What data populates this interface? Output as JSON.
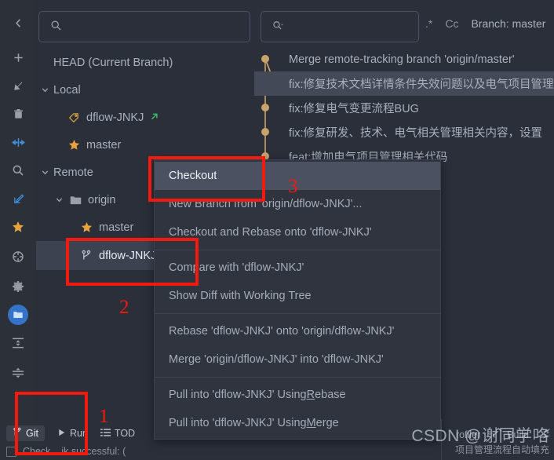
{
  "window": {
    "background": "#2b2f3a",
    "accent": "#3c7ef0"
  },
  "toolstrip": {
    "icons": [
      {
        "name": "collapse-left-icon",
        "glyph": "chevron-left"
      },
      {
        "name": "add-icon",
        "glyph": "plus"
      },
      {
        "name": "import-arrow-icon",
        "glyph": "arrow-down-left"
      },
      {
        "name": "delete-icon",
        "glyph": "trash"
      },
      {
        "name": "collapse-all-icon",
        "glyph": "collapse-arrows"
      },
      {
        "name": "search-icon",
        "glyph": "magnifier"
      },
      {
        "name": "edit-icon",
        "glyph": "pencil-arrow"
      },
      {
        "name": "favorite-icon",
        "glyph": "star"
      },
      {
        "name": "locate-icon",
        "glyph": "crosshair"
      },
      {
        "name": "settings-icon",
        "glyph": "gear"
      },
      {
        "name": "project-folder-icon",
        "glyph": "folder"
      },
      {
        "name": "expand-all-icon",
        "glyph": "expand-rows"
      },
      {
        "name": "collapse-rows-icon",
        "glyph": "collapse-rows"
      }
    ]
  },
  "branch_panel": {
    "search": {
      "value": "",
      "placeholder": ""
    },
    "tree": [
      {
        "label": "HEAD (Current Branch)",
        "icon": "none",
        "indent": 1,
        "chevron": "none",
        "state": "normal"
      },
      {
        "label": "Local",
        "icon": "none",
        "indent": 0,
        "chevron": "down",
        "state": "normal"
      },
      {
        "label": "dflow-JNKJ",
        "icon": "tag",
        "indent": 2,
        "chevron": "none",
        "state": "normal",
        "badge": "arrow-up-right"
      },
      {
        "label": "master",
        "icon": "star",
        "indent": 2,
        "chevron": "none",
        "state": "normal"
      },
      {
        "label": "Remote",
        "icon": "none",
        "indent": 0,
        "chevron": "down",
        "state": "normal"
      },
      {
        "label": "origin",
        "icon": "folder",
        "indent": 1,
        "chevron": "down",
        "state": "normal"
      },
      {
        "label": "master",
        "icon": "star",
        "indent": 2,
        "chevron": "none",
        "state": "normal"
      },
      {
        "label": "dflow-JNKJ",
        "icon": "branch",
        "indent": 2,
        "chevron": "none",
        "state": "selected"
      }
    ]
  },
  "log_panel": {
    "search": {
      "value": "",
      "placeholder": ""
    },
    "toolbar": {
      "regex_label": ".*",
      "case_label": "Cc",
      "branch_label": "Branch: master"
    },
    "commits": [
      {
        "message": "Merge remote-tracking branch 'origin/master'",
        "highlighted": false
      },
      {
        "message": "fix:修复技术文档详情条件失效问题以及电气项目管理",
        "highlighted": true
      },
      {
        "message": "fix:修复电气变更流程BUG",
        "highlighted": false
      },
      {
        "message": "fix:修复研发、技术、电气相关管理相关内容，设置",
        "highlighted": false
      },
      {
        "message": "feat:增加电气项目管理相关代码",
        "highlighted": false
      }
    ]
  },
  "context_menu": {
    "items": [
      {
        "label": "Checkout",
        "selected": true,
        "separator_after": false
      },
      {
        "label": "New Branch from 'origin/dflow-JNKJ'...",
        "selected": false,
        "separator_after": false
      },
      {
        "label": "Checkout and Rebase onto 'dflow-JNKJ'",
        "selected": false,
        "separator_after": true
      },
      {
        "label": "Compare with 'dflow-JNKJ'",
        "selected": false,
        "separator_after": false
      },
      {
        "label": "Show Diff with Working Tree",
        "selected": false,
        "separator_after": true
      },
      {
        "label": "Rebase 'dflow-JNKJ' onto 'origin/dflow-JNKJ'",
        "selected": false,
        "separator_after": false
      },
      {
        "label": "Merge 'origin/dflow-JNKJ' into 'dflow-JNKJ'",
        "selected": false,
        "separator_after": true
      },
      {
        "label": "Pull into 'dflow-JNKJ' Using Rebase",
        "selected": false,
        "separator_after": false,
        "mnemonic": "R"
      },
      {
        "label": "Pull into 'dflow-JNKJ' Using Merge",
        "selected": false,
        "separator_after": false,
        "mnemonic": "M"
      }
    ]
  },
  "bottom_bar": {
    "items": [
      {
        "label": "Git",
        "icon": "branch-icon",
        "active": true
      },
      {
        "label": "Run",
        "icon": "play-icon",
        "active": false
      },
      {
        "label": "TOD",
        "icon": "list-icon",
        "active": false
      }
    ],
    "right_items": [
      {
        "label": "rofiler",
        "icon": "profiler-icon"
      },
      {
        "label": "Build",
        "icon": "hammer-icon"
      }
    ],
    "status_text": "Check... ik successful: ("
  },
  "annotations": {
    "markers": [
      {
        "number": "1",
        "target": "git-tool-window-button"
      },
      {
        "number": "2",
        "target": "remote-branch-dflow-jnkj"
      },
      {
        "number": "3",
        "target": "checkout-menu-item"
      }
    ],
    "color": "#f21a0e"
  },
  "watermark": {
    "line1": "CSDN @谢同学咯",
    "line2": "项目管理流程自动填充"
  }
}
